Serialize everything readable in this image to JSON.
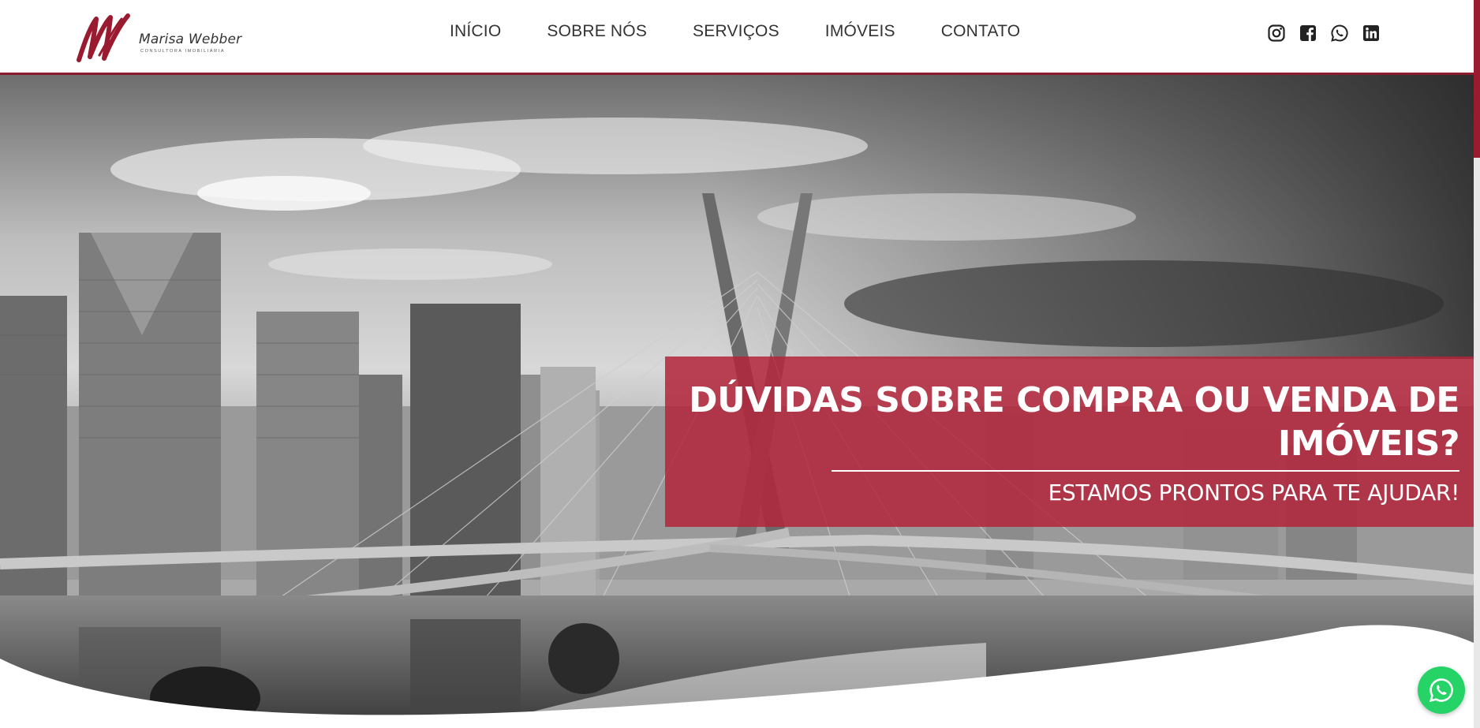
{
  "brand": {
    "logo_mark": "MW",
    "name": "Marisa Webber",
    "tagline": "CONSULTORA IMOBILIÁRIA",
    "accent_color": "#9a1b30"
  },
  "nav": {
    "items": [
      {
        "label": "INÍCIO"
      },
      {
        "label": "SOBRE NÓS"
      },
      {
        "label": "SERVIÇOS"
      },
      {
        "label": "IMÓVEIS"
      },
      {
        "label": "CONTATO"
      }
    ]
  },
  "socials": [
    "instagram-icon",
    "facebook-icon",
    "whatsapp-icon",
    "linkedin-icon"
  ],
  "hero": {
    "title": "DÚVIDAS SOBRE COMPRA OU VENDA DE IMÓVEIS?",
    "subtitle": "ESTAMOS PRONTOS PARA TE AJUDAR!",
    "overlay_color": "#b2243a"
  },
  "floating_button": {
    "icon": "whatsapp-icon",
    "color": "#25d366"
  }
}
